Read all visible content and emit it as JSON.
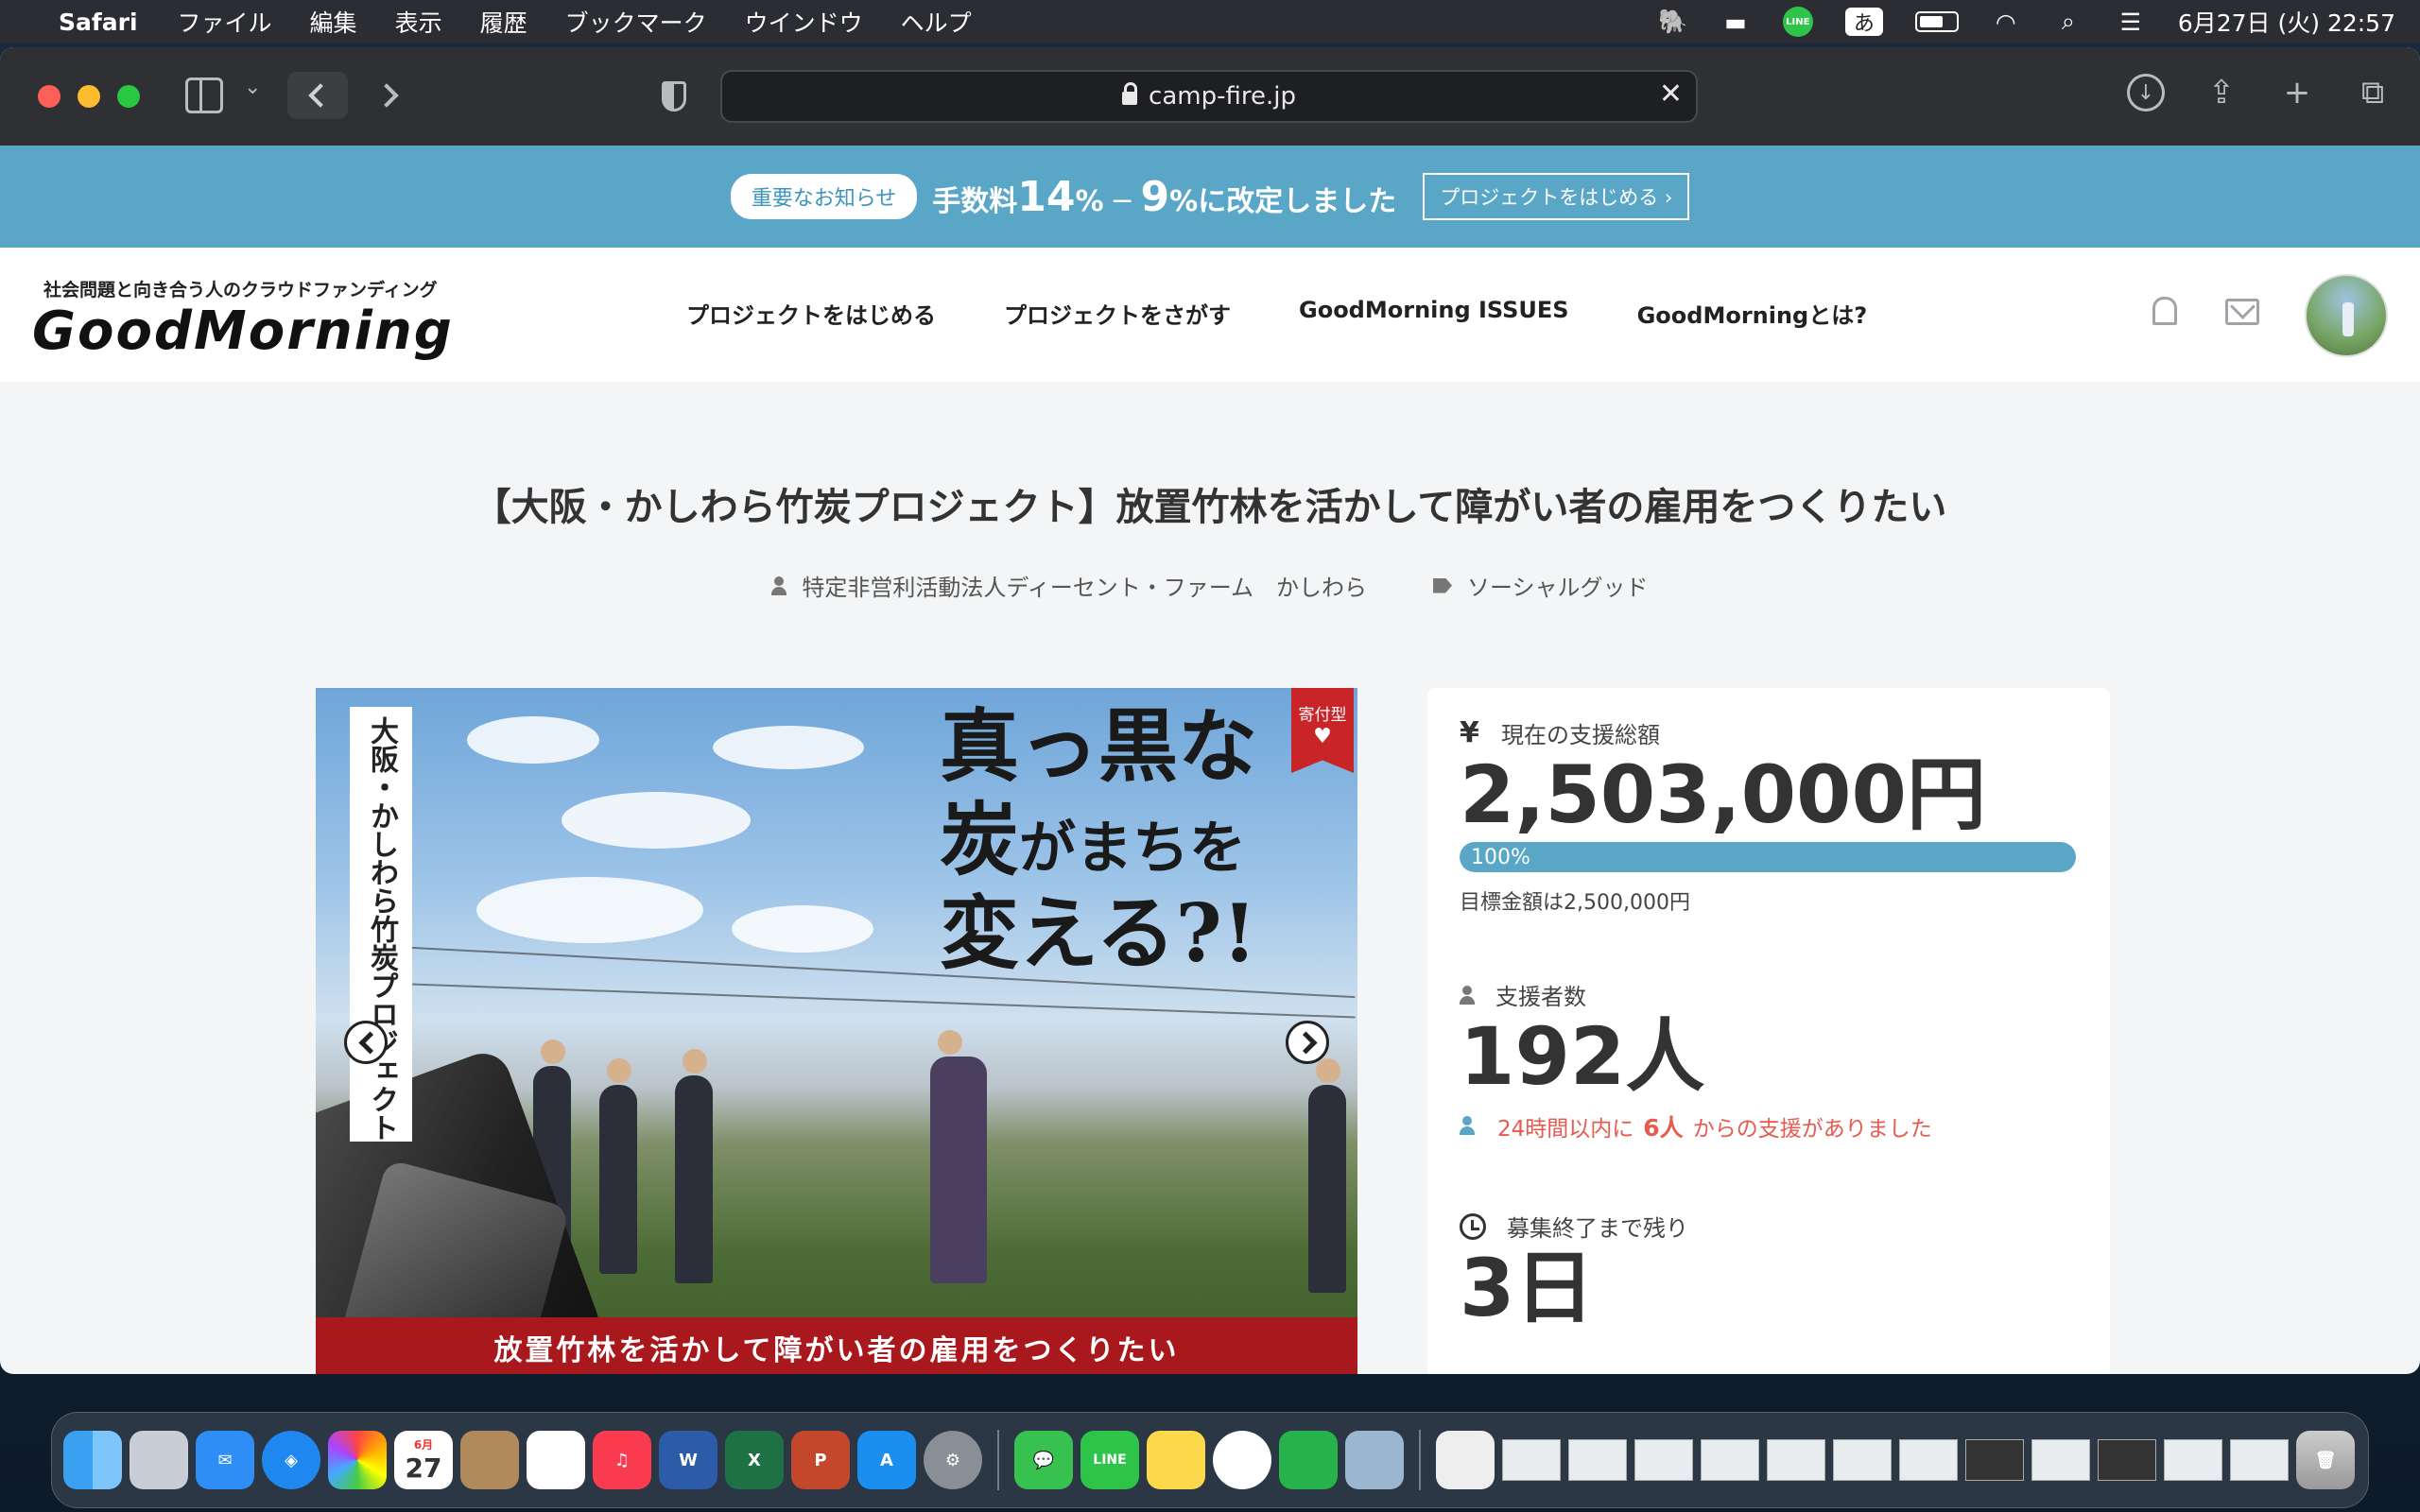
{
  "menubar": {
    "app": "Safari",
    "items": [
      "ファイル",
      "編集",
      "表示",
      "履歴",
      "ブックマーク",
      "ウインドウ",
      "ヘルプ"
    ],
    "line_icon": "LINE",
    "input_mode": "あ",
    "datetime": "6月27日 (火)  22:57"
  },
  "browser": {
    "url": "camp-fire.jp",
    "clear": "✕"
  },
  "banner": {
    "pill": "重要なお知らせ",
    "text_prefix": "手数料",
    "old_fee": "14",
    "pct1": "%",
    "arrow": " ─ ",
    "new_fee": "9",
    "text_suffix": "%に改定しました",
    "cta": "プロジェクトをはじめる ›"
  },
  "header": {
    "tagline": "社会問題と向き合う人のクラウドファンディング",
    "logo": "GoodMorning",
    "nav": [
      "プロジェクトをはじめる",
      "プロジェクトをさがす",
      "GoodMorning ISSUES",
      "GoodMorningとは?"
    ]
  },
  "project": {
    "title": "【大阪・かしわら竹炭プロジェクト】放置竹林を活かして障がい者の雇用をつくりたい",
    "owner": "特定非営利活動法人ディーセント・ファーム　かしわら",
    "category": "ソーシャルグッド",
    "hero": {
      "vertical_title": "大阪・かしわら竹炭プロジェクト",
      "catch_line1": "真っ黒な",
      "catch_line2_a": "炭",
      "catch_line2_b": "がまちを",
      "catch_line3": "変える?!",
      "donation_tag": "寄付型",
      "caption": "放置竹林を活かして障がい者の雇用をつくりたい"
    }
  },
  "stats": {
    "total_label": "現在の支援総額",
    "total": "2,503,000円",
    "progress_label": "100%",
    "progress_fraction": 1.0,
    "goal": "目標金額は2,500,000円",
    "supporters_label": "支援者数",
    "supporters": "192人",
    "recent_prefix": "24時間以内に",
    "recent_count": "6人",
    "recent_suffix": "からの支援がありました",
    "remaining_label": "募集終了まで残り",
    "remaining": "3日"
  },
  "dock": {
    "calendar_month": "6月",
    "calendar_day": "27",
    "line_label": "LINE"
  },
  "colors": {
    "accent": "#5aa6c6",
    "alert": "#e55b4f",
    "caption_red": "#a8181c"
  }
}
